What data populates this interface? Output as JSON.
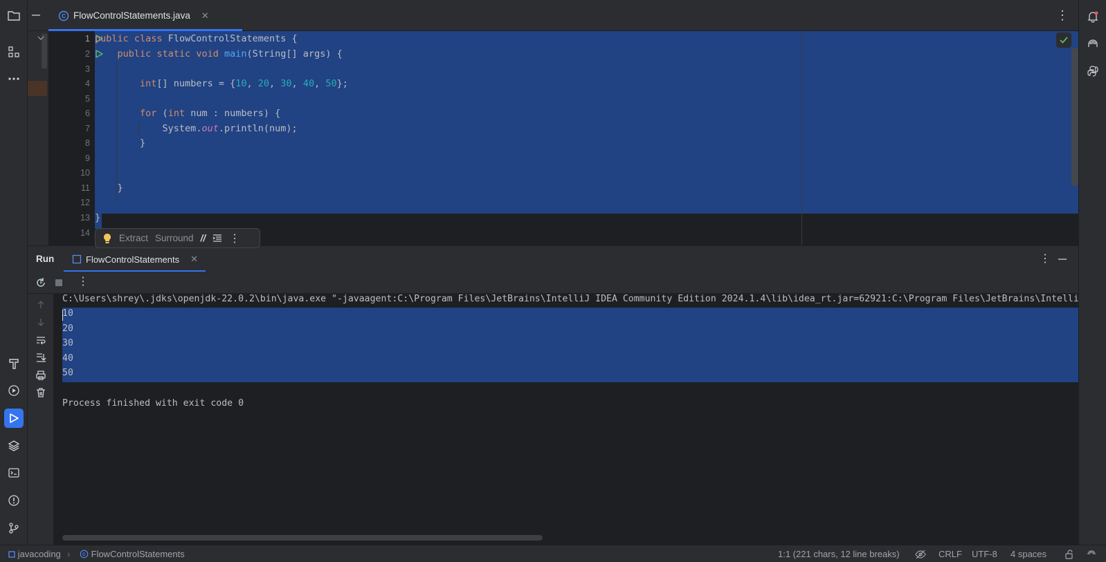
{
  "editor": {
    "tab": {
      "title": "FlowControlStatements.java"
    },
    "line_numbers": [
      "1",
      "2",
      "3",
      "4",
      "5",
      "6",
      "7",
      "8",
      "9",
      "10",
      "11",
      "12",
      "13",
      "14"
    ],
    "code": {
      "l1": {
        "kw1": "public",
        "kw2": "class",
        "name": "FlowControlStatements",
        "rest": " {"
      },
      "l2": {
        "kw1": "public",
        "kw2": "static",
        "kw3": "void",
        "fn": "main",
        "rest": "(String[] args) {"
      },
      "l4": {
        "type": "int",
        "decl": "[] numbers = {",
        "n1": "10",
        "n2": "20",
        "n3": "30",
        "n4": "40",
        "n5": "50",
        "sep": ", ",
        "end": "};"
      },
      "l6": {
        "kw": "for",
        "open": " (",
        "type": "int",
        "rest": " num : numbers) {"
      },
      "l7": {
        "pre": "System.",
        "field": "out",
        "rest": ".println(num);"
      },
      "l8": "}",
      "l11": "}",
      "l13": "}"
    }
  },
  "intention_bar": {
    "extract": "Extract",
    "surround": "Surround"
  },
  "run_panel": {
    "title": "Run",
    "tab": "FlowControlStatements"
  },
  "console": {
    "command": "C:\\Users\\shrey\\.jdks\\openjdk-22.0.2\\bin\\java.exe \"-javaagent:C:\\Program Files\\JetBrains\\IntelliJ IDEA Community Edition 2024.1.4\\lib\\idea_rt.jar=62921:C:\\Program Files\\JetBrains\\Intelli",
    "output": [
      "10",
      "20",
      "30",
      "40",
      "50"
    ],
    "finished": "Process finished with exit code 0"
  },
  "status_bar": {
    "project": "javacoding",
    "file": "FlowControlStatements",
    "position": "1:1 (221 chars, 12 line breaks)",
    "line_ending": "CRLF",
    "encoding": "UTF-8",
    "indent": "4 spaces"
  },
  "colors": {
    "accent": "#3574f0",
    "selection": "#214283",
    "keyword": "#cf8e6d",
    "function": "#56a8f5",
    "number": "#2aacb8"
  }
}
